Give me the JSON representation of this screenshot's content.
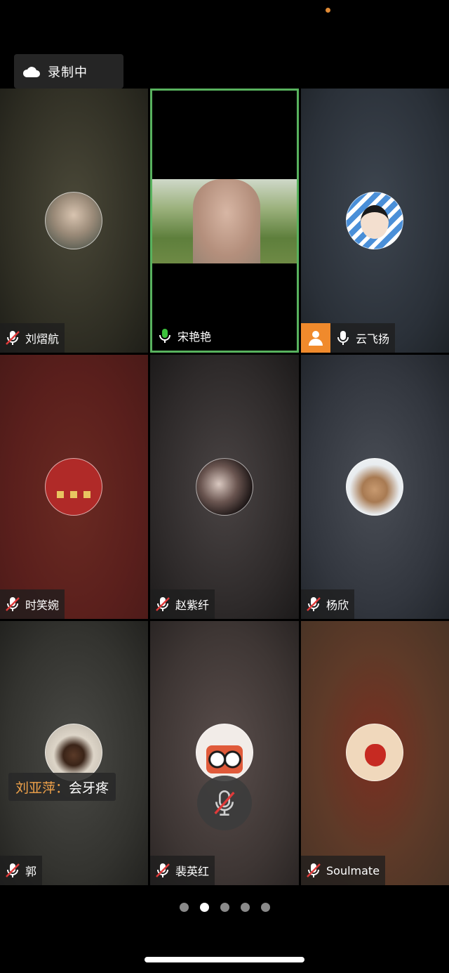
{
  "status": {
    "recording_label": "录制中"
  },
  "participants": [
    {
      "name": "刘熠航",
      "mic": "muted"
    },
    {
      "name": "宋艳艳",
      "mic": "on",
      "active_speaker": true,
      "video": true
    },
    {
      "name": "云飞扬",
      "mic": "on",
      "host_badge": true
    },
    {
      "name": "时笑婉",
      "mic": "muted"
    },
    {
      "name": "赵紫纤",
      "mic": "muted"
    },
    {
      "name": "杨欣",
      "mic": "muted"
    },
    {
      "name": "郭",
      "mic": "muted"
    },
    {
      "name": "裴英红",
      "mic": "muted"
    },
    {
      "name": "Soulmate",
      "mic": "muted"
    }
  ],
  "caption": {
    "speaker": "刘亚萍：",
    "text": "会牙疼"
  },
  "pager": {
    "pages": 5,
    "current": 2
  },
  "colors": {
    "active_border": "#58b25e",
    "mic_on": "#3cc13c",
    "host_badge": "#f08a2c",
    "caption_speaker": "#f0a24a"
  }
}
